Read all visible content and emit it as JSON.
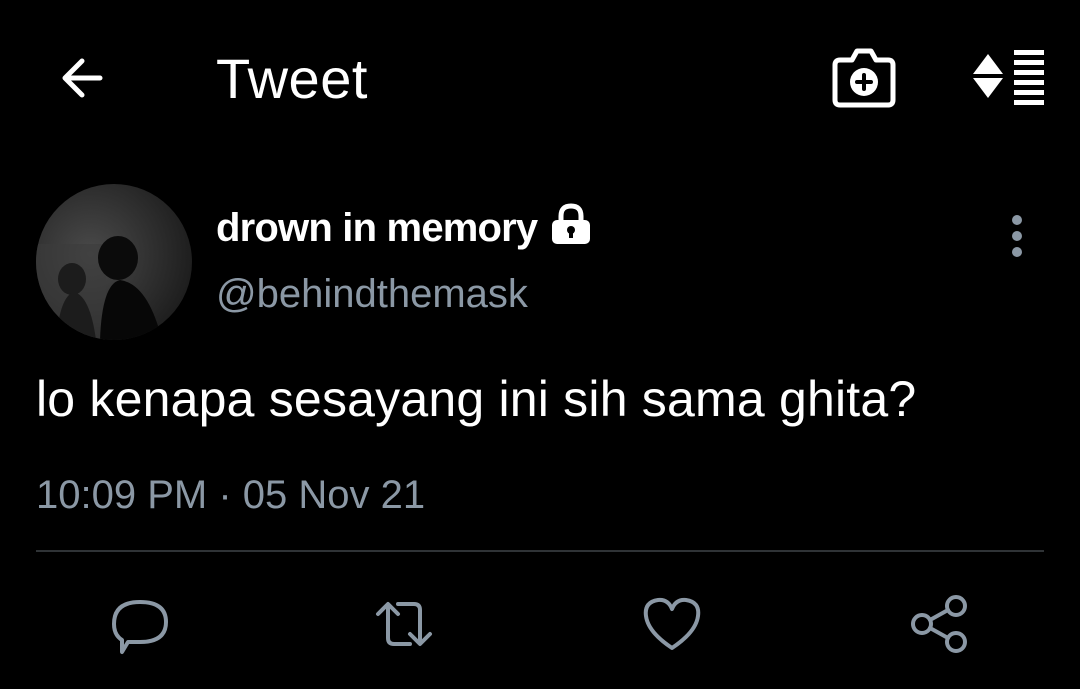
{
  "header": {
    "title": "Tweet",
    "icons": {
      "back": "arrow-left-icon",
      "camera": "camera-plus-icon",
      "sort": "sort-icon"
    }
  },
  "tweet": {
    "author": {
      "display_name": "drown in memory",
      "username": "@behindthemask",
      "protected_icon": "lock-icon",
      "avatar": "avatar"
    },
    "text": "lo kenapa sesayang ini sih sama ghita?",
    "timestamp": "10:09 PM · 05 Nov 21"
  },
  "actions": {
    "icons": [
      "reply-icon",
      "retweet-icon",
      "like-icon",
      "share-icon"
    ]
  },
  "colors": {
    "background": "#000000",
    "primary_text": "#ffffff",
    "secondary_text": "#8b98a5",
    "divider": "#2f3336"
  }
}
